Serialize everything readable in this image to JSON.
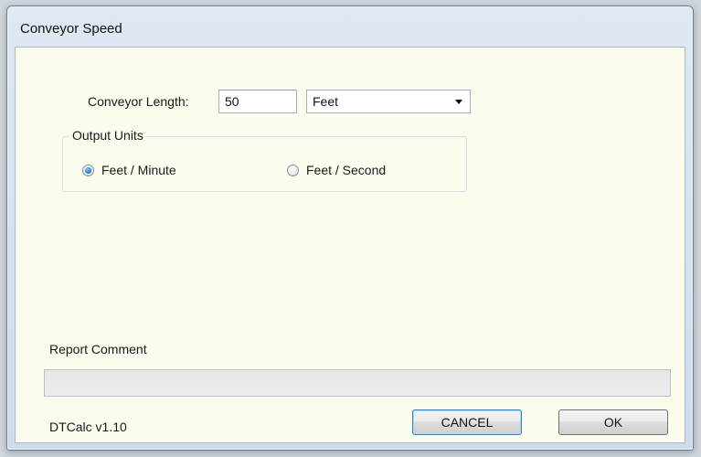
{
  "window": {
    "title": "Conveyor Speed"
  },
  "length": {
    "label": "Conveyor Length:",
    "value": "50",
    "unit_selected": "Feet"
  },
  "output_units": {
    "title": "Output Units",
    "options": [
      {
        "label": "Feet / Minute",
        "checked": true
      },
      {
        "label": "Feet / Second",
        "checked": false
      }
    ]
  },
  "comment": {
    "label": "Report Comment",
    "value": ""
  },
  "footer": {
    "version": "DTCalc v1.10",
    "cancel_label": "CANCEL",
    "ok_label": "OK"
  },
  "colors": {
    "client_background": "#fbfbee",
    "radio_checked": "#2a7fd4",
    "default_button_border": "#3c7fb1"
  },
  "icons": {
    "dropdown_arrow": "chevron-down-icon"
  }
}
